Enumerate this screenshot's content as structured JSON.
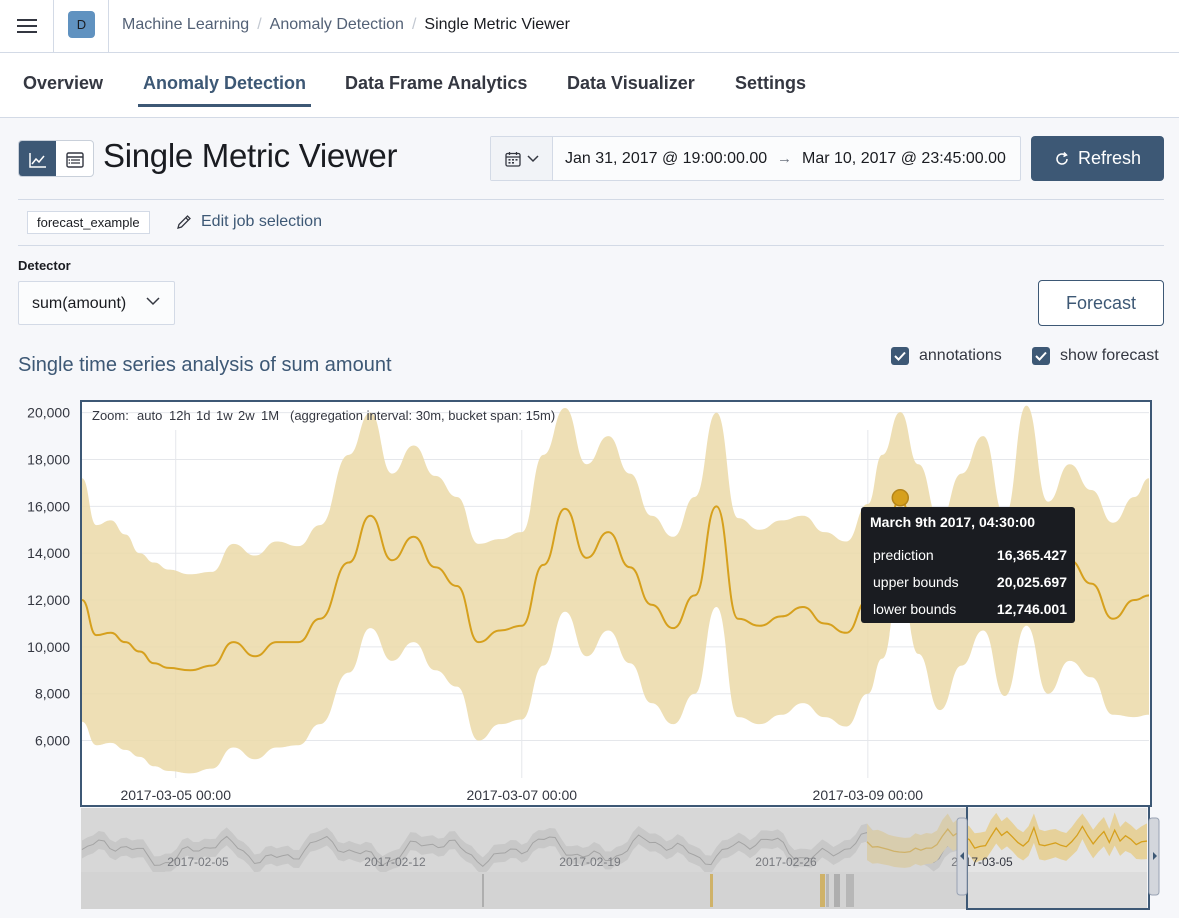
{
  "header": {
    "space_initial": "D",
    "breadcrumbs": [
      "Machine Learning",
      "Anomaly Detection"
    ],
    "current": "Single Metric Viewer"
  },
  "tabs": [
    "Overview",
    "Anomaly Detection",
    "Data Frame Analytics",
    "Data Visualizer",
    "Settings"
  ],
  "active_tab": "Anomaly Detection",
  "page": {
    "title": "Single Metric Viewer"
  },
  "timepicker": {
    "start": "Jan 31, 2017 @ 19:00:00.00",
    "arrow": "→",
    "end": "Mar 10, 2017 @ 23:45:00.00",
    "refresh_label": "Refresh"
  },
  "job": {
    "id": "forecast_example",
    "edit_label": "Edit job selection"
  },
  "detector": {
    "label": "Detector",
    "value": "sum(amount)"
  },
  "forecast_label": "Forecast",
  "analysis_title": "Single time series analysis of sum amount",
  "checkboxes": {
    "annotations": "annotations",
    "show_forecast": "show forecast"
  },
  "zoom": {
    "label": "Zoom:",
    "options": [
      "auto",
      "12h",
      "1d",
      "1w",
      "2w",
      "1M"
    ],
    "info": "(aggregation interval: 30m, bucket span: 15m)"
  },
  "tooltip": {
    "title": "March 9th 2017, 04:30:00",
    "rows": [
      {
        "label": "prediction",
        "value": "16,365.427"
      },
      {
        "label": "upper bounds",
        "value": "20,025.697"
      },
      {
        "label": "lower bounds",
        "value": "12,746.001"
      }
    ]
  },
  "colors": {
    "accent": "#3d5875",
    "forecast_line": "#d6a01d",
    "forecast_band": "#ebd9a8",
    "context_band": "#d3d3d3"
  },
  "chart_data": {
    "type": "line",
    "ylim": [
      4400,
      20200
    ],
    "y_ticks": [
      "20,000",
      "18,000",
      "16,000",
      "14,000",
      "12,000",
      "10,000",
      "8,000",
      "6,000"
    ],
    "x_ticks": [
      "2017-03-05 00:00",
      "2017-03-07 00:00",
      "2017-03-09 00:00"
    ],
    "context_ticks": [
      "2017-02-05",
      "2017-02-12",
      "2017-02-19",
      "2017-02-26",
      "2017-03-05"
    ],
    "series": [
      {
        "x": [
          "2017-03-04 11:00",
          "2017-03-04 13:00",
          "2017-03-04 15:00",
          "2017-03-04 17:00",
          "2017-03-04 19:00",
          "2017-03-04 21:00",
          "2017-03-04 23:00",
          "2017-03-05 02:00",
          "2017-03-05 05:00",
          "2017-03-05 08:00",
          "2017-03-05 11:00",
          "2017-03-05 14:00",
          "2017-03-05 17:00",
          "2017-03-05 20:00",
          "2017-03-06 00:00",
          "2017-03-06 03:00",
          "2017-03-06 06:00",
          "2017-03-06 09:00",
          "2017-03-06 12:00",
          "2017-03-06 15:00",
          "2017-03-06 18:00",
          "2017-03-06 21:00",
          "2017-03-07 00:00",
          "2017-03-07 03:00",
          "2017-03-07 06:00",
          "2017-03-07 09:00",
          "2017-03-07 12:00",
          "2017-03-07 15:00",
          "2017-03-07 18:00",
          "2017-03-07 21:00",
          "2017-03-08 00:00",
          "2017-03-08 03:00",
          "2017-03-08 06:00",
          "2017-03-08 09:00",
          "2017-03-08 12:00",
          "2017-03-08 15:00",
          "2017-03-08 18:00",
          "2017-03-08 21:00",
          "2017-03-09 00:00",
          "2017-03-09 02:00",
          "2017-03-09 04:30",
          "2017-03-09 07:00",
          "2017-03-09 10:00",
          "2017-03-09 13:00",
          "2017-03-09 16:00",
          "2017-03-09 19:00",
          "2017-03-09 22:00",
          "2017-03-10 01:00",
          "2017-03-10 04:00",
          "2017-03-10 07:00",
          "2017-03-10 10:00",
          "2017-03-10 13:00",
          "2017-03-10 15:00"
        ],
        "prediction": [
          12000,
          10500,
          10600,
          10200,
          9800,
          9300,
          9100,
          9000,
          9200,
          10200,
          9600,
          10200,
          10200,
          11200,
          13600,
          15600,
          13700,
          14700,
          13400,
          12600,
          10200,
          10700,
          10900,
          13500,
          15900,
          13800,
          14900,
          13400,
          11800,
          10800,
          12200,
          16000,
          11200,
          10900,
          11300,
          11700,
          11000,
          10600,
          12000,
          13800,
          16365,
          13700,
          11400,
          13300,
          14900,
          11800,
          15300,
          12200,
          13700,
          12700,
          11200,
          12000,
          12200
        ],
        "upper": [
          17200,
          15200,
          15400,
          14800,
          14000,
          13600,
          13300,
          13100,
          13200,
          14400,
          13900,
          14500,
          14300,
          15200,
          18200,
          20000,
          17400,
          18600,
          17300,
          16400,
          14400,
          14600,
          14900,
          18200,
          20200,
          17800,
          19000,
          17400,
          15600,
          14700,
          16400,
          20000,
          15500,
          15000,
          15400,
          15600,
          14900,
          14500,
          16100,
          18200,
          20026,
          17800,
          15400,
          17400,
          19000,
          15600,
          20300,
          16200,
          17800,
          16700,
          15300,
          16400,
          17200
        ],
        "lower": [
          6800,
          5800,
          5900,
          5600,
          5300,
          4900,
          4700,
          4600,
          4800,
          5700,
          5200,
          5700,
          5800,
          6700,
          8900,
          10800,
          9400,
          10200,
          9000,
          8300,
          6000,
          6700,
          6900,
          9200,
          11500,
          9600,
          10700,
          9300,
          7600,
          6700,
          8000,
          11700,
          7000,
          6700,
          7100,
          7600,
          7000,
          6600,
          8000,
          9500,
          12746,
          9700,
          7300,
          9200,
          10700,
          7900,
          10900,
          8000,
          9400,
          8700,
          7100,
          7000,
          7100
        ]
      }
    ]
  }
}
